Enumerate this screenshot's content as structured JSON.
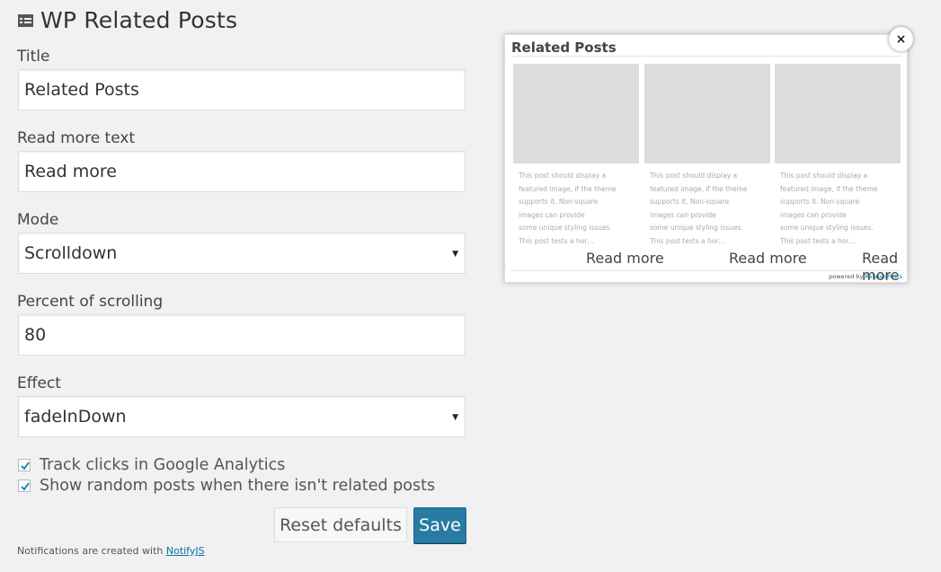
{
  "header": {
    "title": "WP Related Posts",
    "icon": "list-table-icon"
  },
  "form": {
    "title_label": "Title",
    "title_value": "Related Posts",
    "readmore_label": "Read more text",
    "readmore_value": "Read more",
    "mode_label": "Mode",
    "mode_value": "Scrolldown",
    "percent_label": "Percent of scrolling",
    "percent_value": "80",
    "effect_label": "Effect",
    "effect_value": "fadeInDown",
    "caret": "▼",
    "track_label": "Track clicks in Google Analytics",
    "track_checked": true,
    "random_label": "Show random posts when there isn't related posts",
    "random_checked": true
  },
  "buttons": {
    "reset": "Reset defaults",
    "save": "Save"
  },
  "footer": {
    "text": "Notifications are created with ",
    "link": "NotifyJS"
  },
  "preview": {
    "title": "Related Posts",
    "close": "×",
    "excerpt": "This post should display a\nfeatured image, if the theme\nsupports it. Non-square\nimages can provide\nsome unique styling issues.\nThis post tests a hor…",
    "read_more": "Read more",
    "powered_prefix": "powered by ",
    "powered_link": "RelatedPosts"
  },
  "colors": {
    "accent": "#2a7ba3",
    "background": "#f1f1f1"
  }
}
